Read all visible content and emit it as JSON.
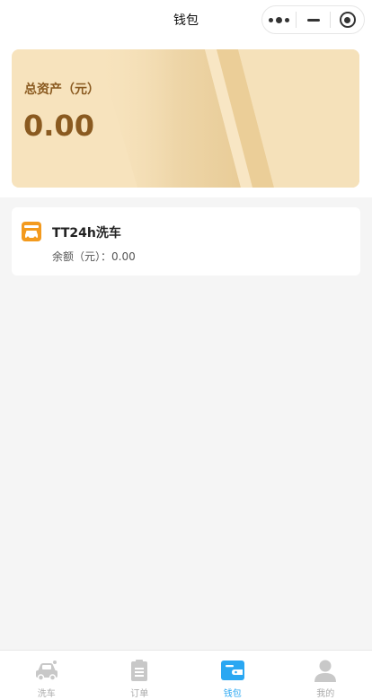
{
  "header": {
    "title": "钱包",
    "capsule": {
      "more_icon": "more-dots-icon",
      "minimize_icon": "minimize-icon",
      "close_icon": "target-circle-icon"
    }
  },
  "assets": {
    "label": "总资产（元）",
    "value": "0.00"
  },
  "wallets": [
    {
      "name": "TT24h洗车",
      "balance_text": "余额（元）：0.00",
      "icon": "car-wash-icon"
    }
  ],
  "tabbar": {
    "items": [
      {
        "label": "洗车",
        "icon": "car-icon",
        "active": false
      },
      {
        "label": "订单",
        "icon": "clipboard-icon",
        "active": false
      },
      {
        "label": "钱包",
        "icon": "wallet-icon",
        "active": true
      },
      {
        "label": "我的",
        "icon": "user-icon",
        "active": false
      }
    ]
  },
  "colors": {
    "accent": "#2aa7f2",
    "card_gold": "#8a5a20",
    "brand_orange": "#f39a1e"
  }
}
